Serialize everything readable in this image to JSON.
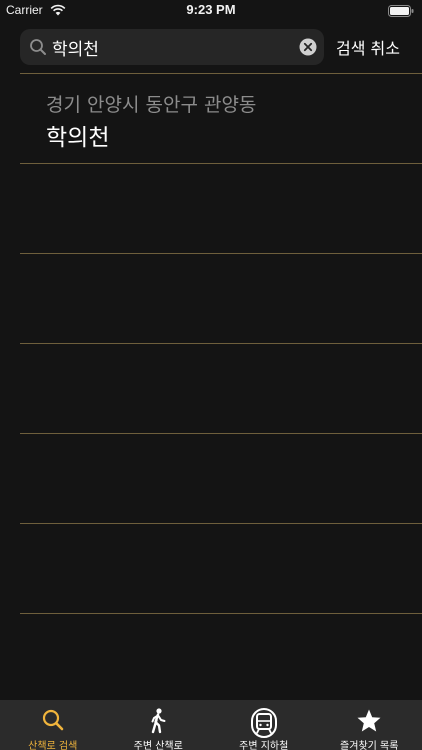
{
  "status_bar": {
    "carrier": "Carrier",
    "time": "9:23 PM"
  },
  "search": {
    "value": "학의천",
    "cancel_label": "검색 취소"
  },
  "results": [
    {
      "subtitle": "경기 안양시 동안구 관양동",
      "title": "학의천"
    },
    {
      "subtitle": "",
      "title": ""
    },
    {
      "subtitle": "",
      "title": ""
    },
    {
      "subtitle": "",
      "title": ""
    },
    {
      "subtitle": "",
      "title": ""
    },
    {
      "subtitle": "",
      "title": ""
    }
  ],
  "tab_bar": {
    "tabs": [
      {
        "label": "산책로 검색",
        "icon": "search-icon",
        "active": true
      },
      {
        "label": "주변 산책로",
        "icon": "walking-person-icon",
        "active": false
      },
      {
        "label": "주변 지하철",
        "icon": "subway-train-icon",
        "active": false
      },
      {
        "label": "즐겨찾기 목록",
        "icon": "star-icon",
        "active": false
      }
    ]
  },
  "colors": {
    "background": "#141414",
    "accent": "#f0b43c",
    "divider": "#6e5f3c",
    "tab_bar": "#2b2b2b",
    "search_field": "#262626"
  }
}
